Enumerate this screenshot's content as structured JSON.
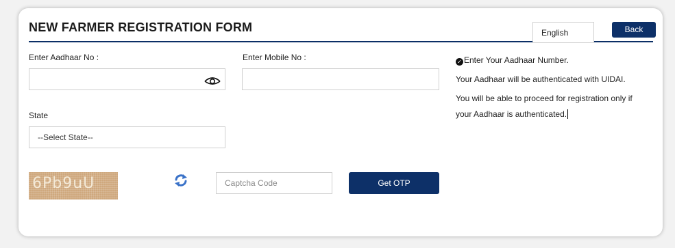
{
  "form": {
    "title": "NEW FARMER REGISTRATION FORM",
    "language": "English",
    "back_label": "Back",
    "aadhaar_label": "Enter Aadhaar No :",
    "aadhaar_value": "",
    "mobile_label": "Enter Mobile No :",
    "mobile_value": "",
    "state_label": "State",
    "state_selected": "--Select State--",
    "captcha_text": "6Pb9uU",
    "captcha_placeholder": "Captcha Code",
    "otp_label": "Get OTP"
  },
  "info": {
    "line1": "Enter Your Aadhaar Number.",
    "line2": "Your Aadhaar will be authenticated with UIDAI.",
    "line3": "You will be able to proceed for registration only if",
    "line4": "your Aadhaar is authenticated."
  },
  "icons": {
    "eye": "eye-icon",
    "refresh": "refresh-icon",
    "check": "check-circle-icon"
  },
  "colors": {
    "primary": "#0d3068",
    "captcha_bg": "#cfa87d",
    "refresh": "#3a72c8"
  }
}
